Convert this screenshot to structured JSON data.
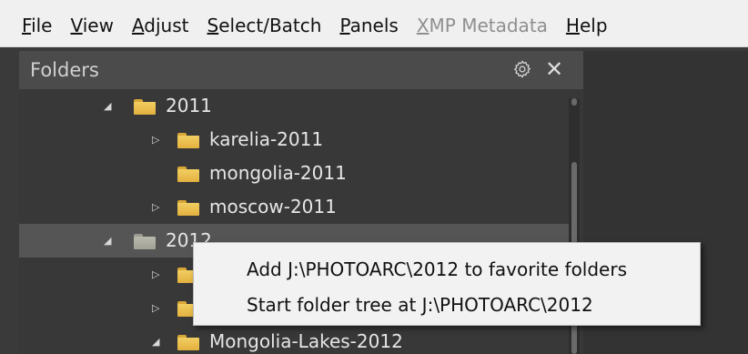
{
  "menubar": {
    "items": [
      {
        "mnemonic": "F",
        "rest": "ile"
      },
      {
        "mnemonic": "V",
        "rest": "iew"
      },
      {
        "mnemonic": "A",
        "rest": "djust"
      },
      {
        "mnemonic": "S",
        "rest": "elect/Batch"
      },
      {
        "mnemonic": "P",
        "rest": "anels"
      },
      {
        "mnemonic": "X",
        "rest": "MP Metadata"
      },
      {
        "mnemonic": "H",
        "rest": "elp"
      }
    ]
  },
  "panel": {
    "title": "Folders",
    "gear_icon": "gear-icon",
    "close_glyph": "✕"
  },
  "tree": {
    "rows": [
      {
        "label": "2011",
        "twisty": "◢",
        "color": "yellow"
      },
      {
        "label": "karelia-2011",
        "twisty": "▷",
        "color": "yellow"
      },
      {
        "label": "mongolia-2011",
        "twisty": "",
        "color": "yellow"
      },
      {
        "label": "moscow-2011",
        "twisty": "▷",
        "color": "yellow"
      },
      {
        "label": "2012",
        "twisty": "◢",
        "color": "gray"
      },
      {
        "label": "",
        "twisty": "▷",
        "color": "yellow"
      },
      {
        "label": "",
        "twisty": "▷",
        "color": "yellow"
      },
      {
        "label": "Mongolia-Lakes-2012",
        "twisty": "◢",
        "color": "yellow"
      }
    ]
  },
  "context_menu": {
    "items": [
      {
        "label": "Add J:\\PHOTOARC\\2012 to favorite folders"
      },
      {
        "label": "Start folder tree at J:\\PHOTOARC\\2012"
      }
    ]
  }
}
